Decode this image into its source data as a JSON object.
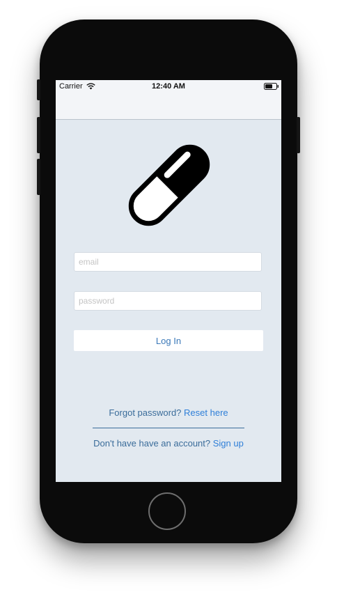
{
  "status_bar": {
    "carrier": "Carrier",
    "time": "12:40 AM",
    "wifi_icon": "wifi-icon",
    "battery_icon": "battery-icon"
  },
  "logo": {
    "icon": "pill-capsule-icon"
  },
  "form": {
    "email_placeholder": "email",
    "email_value": "",
    "password_placeholder": "password",
    "password_value": "",
    "login_label": "Log In"
  },
  "footer": {
    "forgot_text": "Forgot password? ",
    "reset_link": "Reset here",
    "signup_text": "Don't have have an account? ",
    "signup_link": "Sign up"
  },
  "colors": {
    "screen_background": "#e2e9f0",
    "navbar_background": "#f3f5f8",
    "link": "#2f7fd8",
    "text_secondary": "#3a6c9a",
    "button_text": "#3a78b8",
    "device_body": "#0b0b0b"
  }
}
